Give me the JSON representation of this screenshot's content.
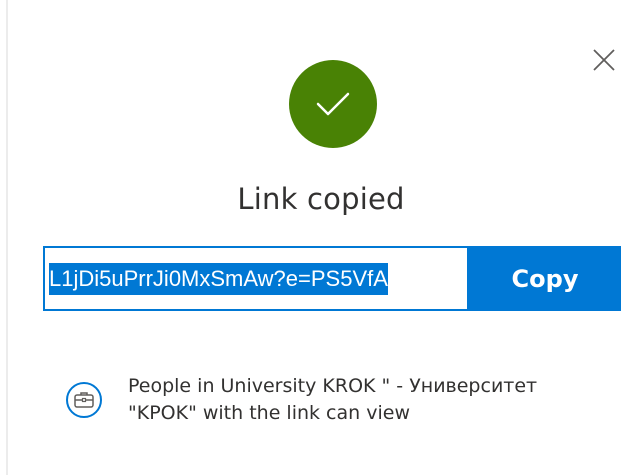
{
  "dialog": {
    "title": "Link copied",
    "close_icon": "close-icon",
    "status_icon": "checkmark-icon",
    "colors": {
      "success": "#498205",
      "accent": "#0078d4",
      "text": "#323130"
    }
  },
  "link": {
    "value": "L1jDi5uPrrJi0MxSmAw?e=PS5VfA",
    "selected": true,
    "copy_label": "Copy"
  },
  "permission": {
    "icon": "briefcase-icon",
    "text": "People in University KROK \" - Университет \"KPOK\" with the link can view"
  }
}
